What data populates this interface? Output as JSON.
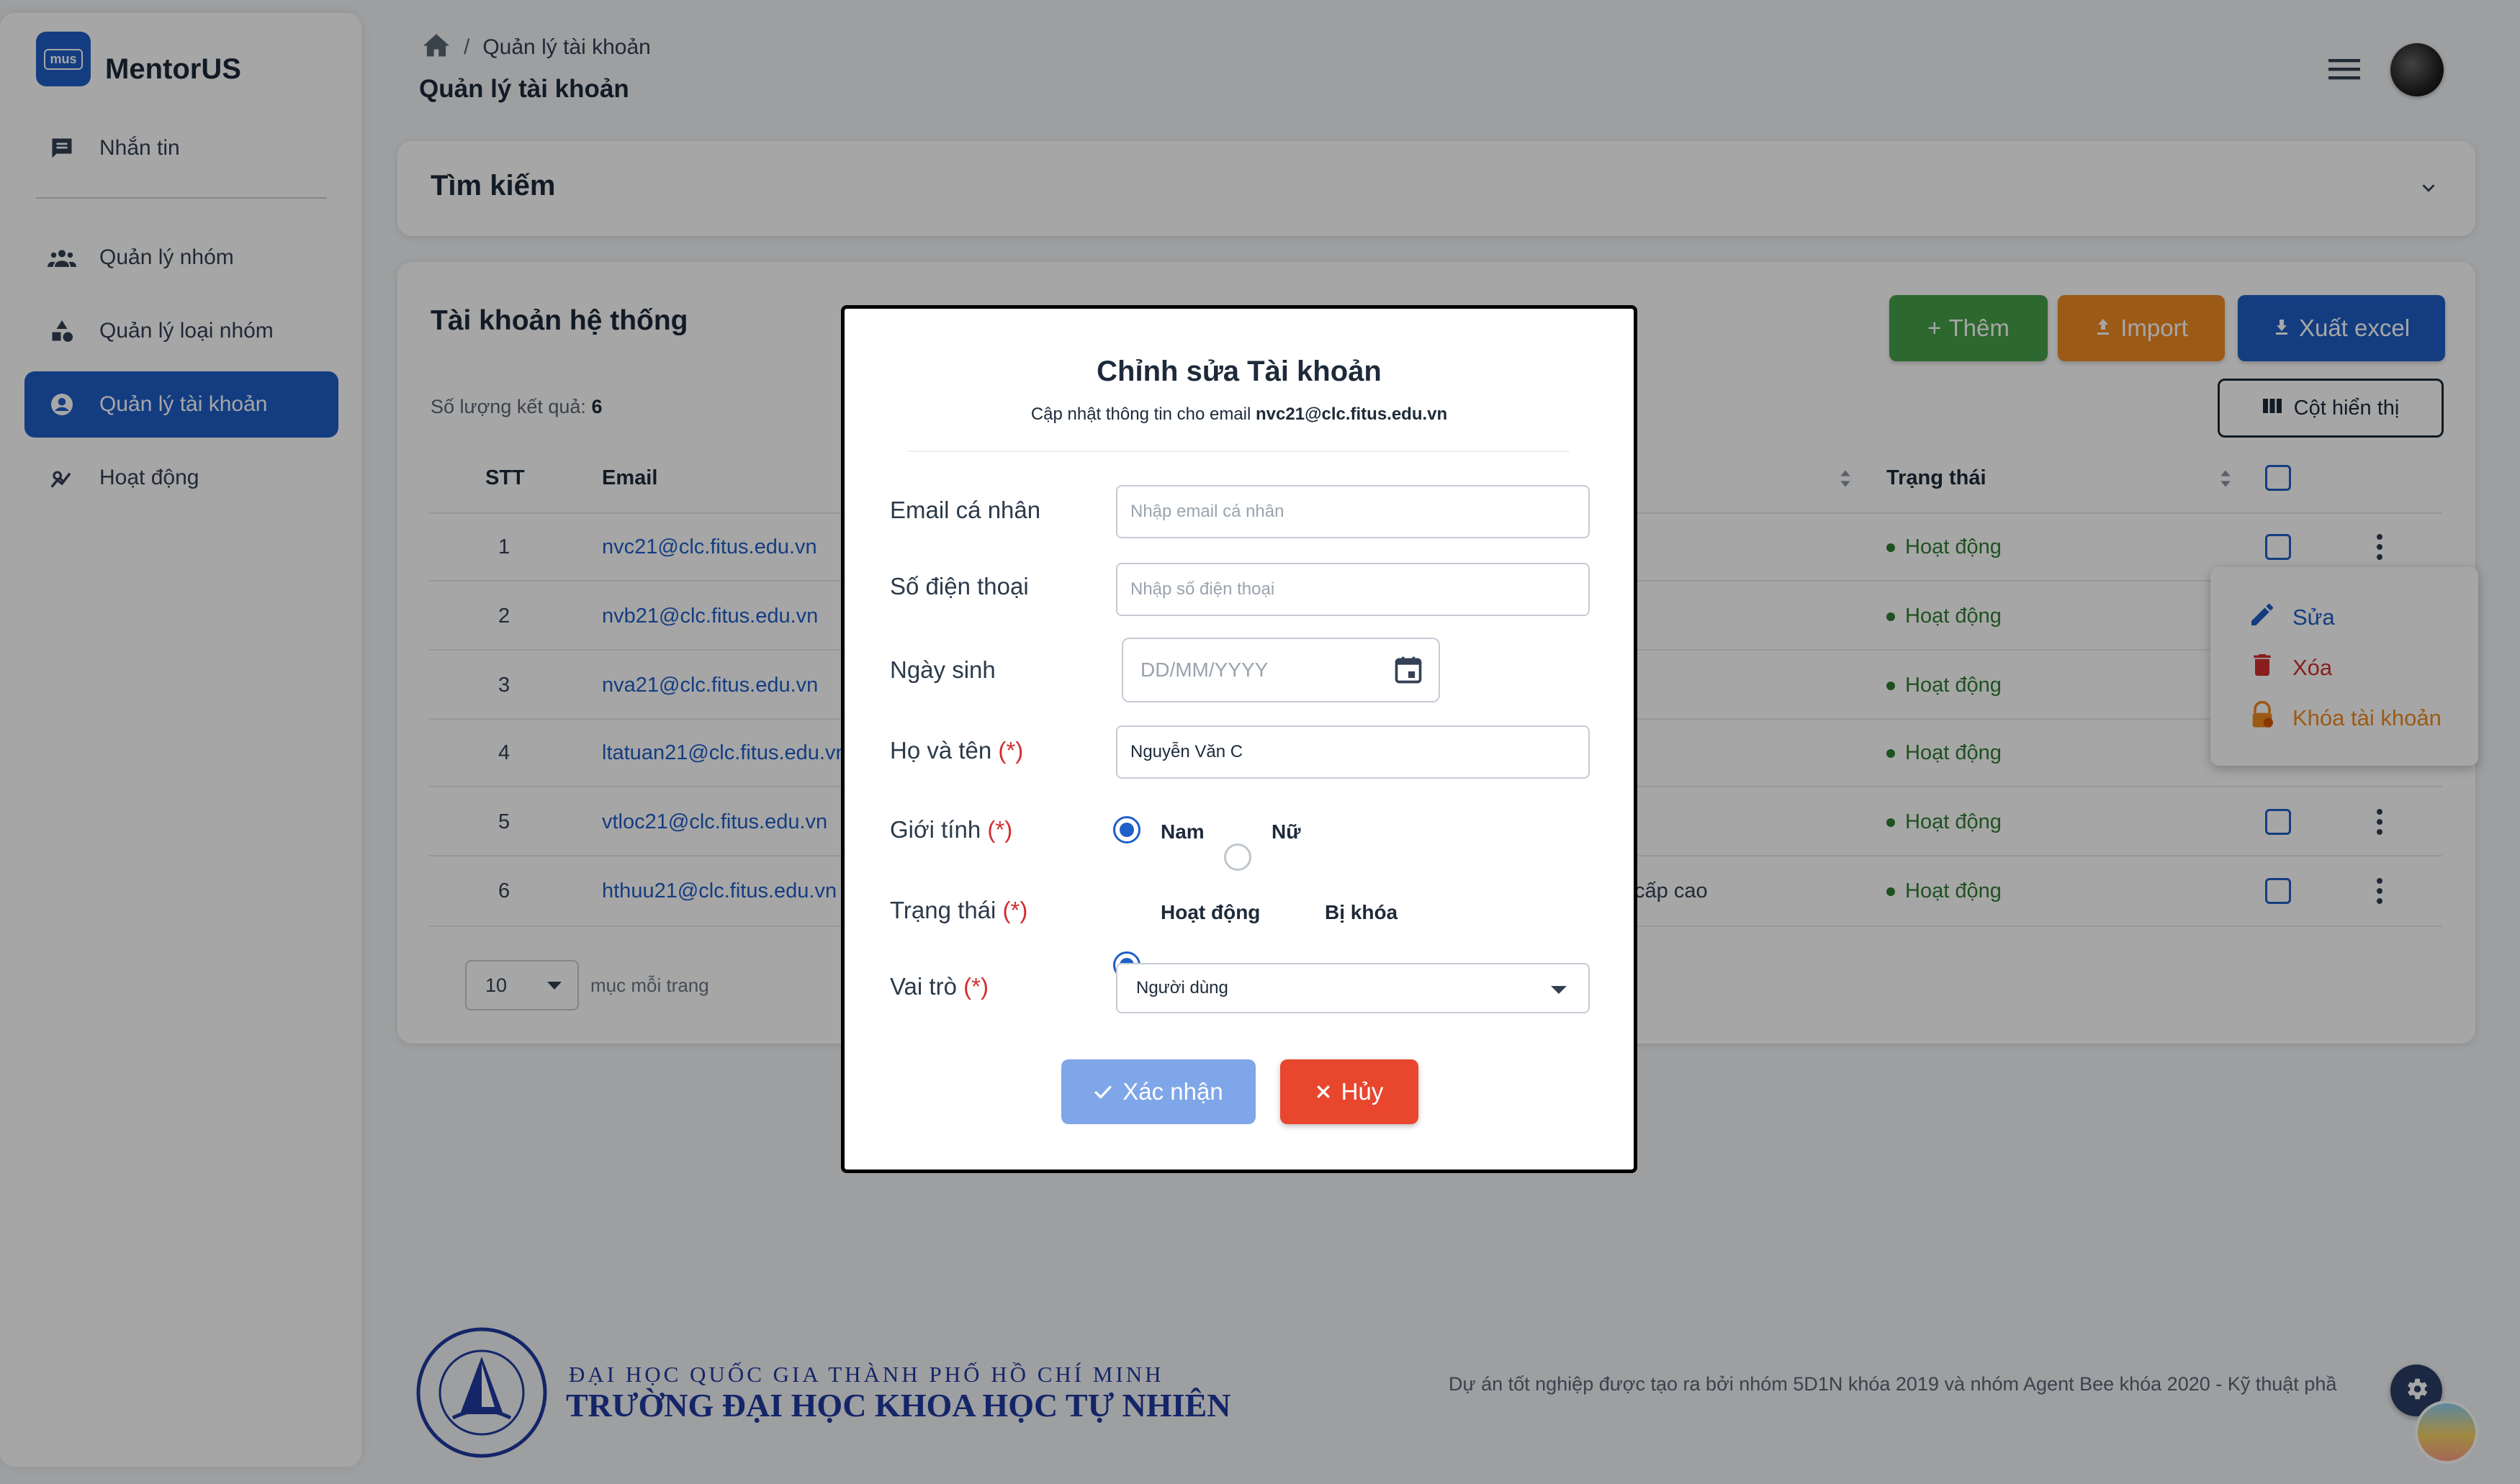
{
  "app": {
    "name": "MentorUS",
    "logo_text": "mus"
  },
  "sidebar": {
    "items": [
      {
        "label": "Nhắn tin",
        "icon": "chat-icon"
      },
      {
        "label": "Quản lý nhóm",
        "icon": "groups-icon"
      },
      {
        "label": "Quản lý loại nhóm",
        "icon": "category-icon"
      },
      {
        "label": "Quản lý tài khoản",
        "icon": "account-circle-icon",
        "active": true
      },
      {
        "label": "Hoạt động",
        "icon": "activity-chart-icon"
      }
    ]
  },
  "header": {
    "breadcrumb": "Quản lý tài khoản",
    "title": "Quản lý tài khoản"
  },
  "search": {
    "title": "Tìm kiếm"
  },
  "table": {
    "title": "Tài khoản hệ thống",
    "result_label": "Số lượng kết quả:",
    "result_count": "6",
    "buttons": {
      "add": "Thêm",
      "import": "Import",
      "export": "Xuất excel",
      "columns": "Cột hiển thị"
    },
    "headers": {
      "stt": "STT",
      "email": "Email",
      "status": "Trạng thái"
    },
    "rows": [
      {
        "stt": "1",
        "email": "nvc21@clc.fitus.edu.vn",
        "role": "",
        "status": "Hoạt động"
      },
      {
        "stt": "2",
        "email": "nvb21@clc.fitus.edu.vn",
        "role": "",
        "status": "Hoạt động"
      },
      {
        "stt": "3",
        "email": "nva21@clc.fitus.edu.vn",
        "role": "",
        "status": "Hoạt động"
      },
      {
        "stt": "4",
        "email": "ltatuan21@clc.fitus.edu.vn",
        "role": "",
        "status": "Hoạt động"
      },
      {
        "stt": "5",
        "email": "vtloc21@clc.fitus.edu.vn",
        "role": "",
        "status": "Hoạt động"
      },
      {
        "stt": "6",
        "email": "hthuu21@clc.fitus.edu.vn",
        "role": "cấp cao",
        "status": "Hoạt động"
      }
    ],
    "page_size": "10",
    "per_page_label": "mục mỗi trang"
  },
  "context_menu": {
    "edit": "Sửa",
    "delete": "Xóa",
    "lock": "Khóa tài khoản"
  },
  "modal": {
    "title": "Chỉnh sửa Tài khoản",
    "subtitle_prefix": "Cập nhật thông tin cho email",
    "subtitle_email": "nvc21@clc.fitus.edu.vn",
    "fields": {
      "personal_email": {
        "label": "Email cá nhân",
        "placeholder": "Nhập email cá nhân"
      },
      "phone": {
        "label": "Số điện thoại",
        "placeholder": "Nhập số điện thoại"
      },
      "birthday": {
        "label": "Ngày sinh",
        "placeholder": "DD/MM/YYYY"
      },
      "fullname": {
        "label": "Họ và tên",
        "value": "Nguyễn Văn C"
      },
      "gender": {
        "label": "Giới tính",
        "options": [
          "Nam",
          "Nữ"
        ],
        "selected": "Nam"
      },
      "status": {
        "label": "Trạng thái",
        "options": [
          "Hoạt động",
          "Bị khóa"
        ],
        "selected": "Hoạt động"
      },
      "role": {
        "label": "Vai trò",
        "value": "Người dùng"
      }
    },
    "required_mark": "(*)",
    "confirm": "Xác nhận",
    "cancel": "Hủy"
  },
  "footer": {
    "uni_line1": "ĐẠI HỌC QUỐC GIA THÀNH PHỐ HỒ CHÍ MINH",
    "uni_line2": "TRƯỜNG ĐẠI HỌC KHOA HỌC TỰ NHIÊN",
    "credit": "Dự án tốt nghiệp được tạo ra bởi nhóm 5D1N khóa 2019 và nhóm Agent Bee khóa 2020 - Kỹ thuật phầ"
  },
  "colors": {
    "primary": "#1f5fc7",
    "success": "#45a049",
    "warning": "#f08a24",
    "danger": "#e8472e"
  }
}
